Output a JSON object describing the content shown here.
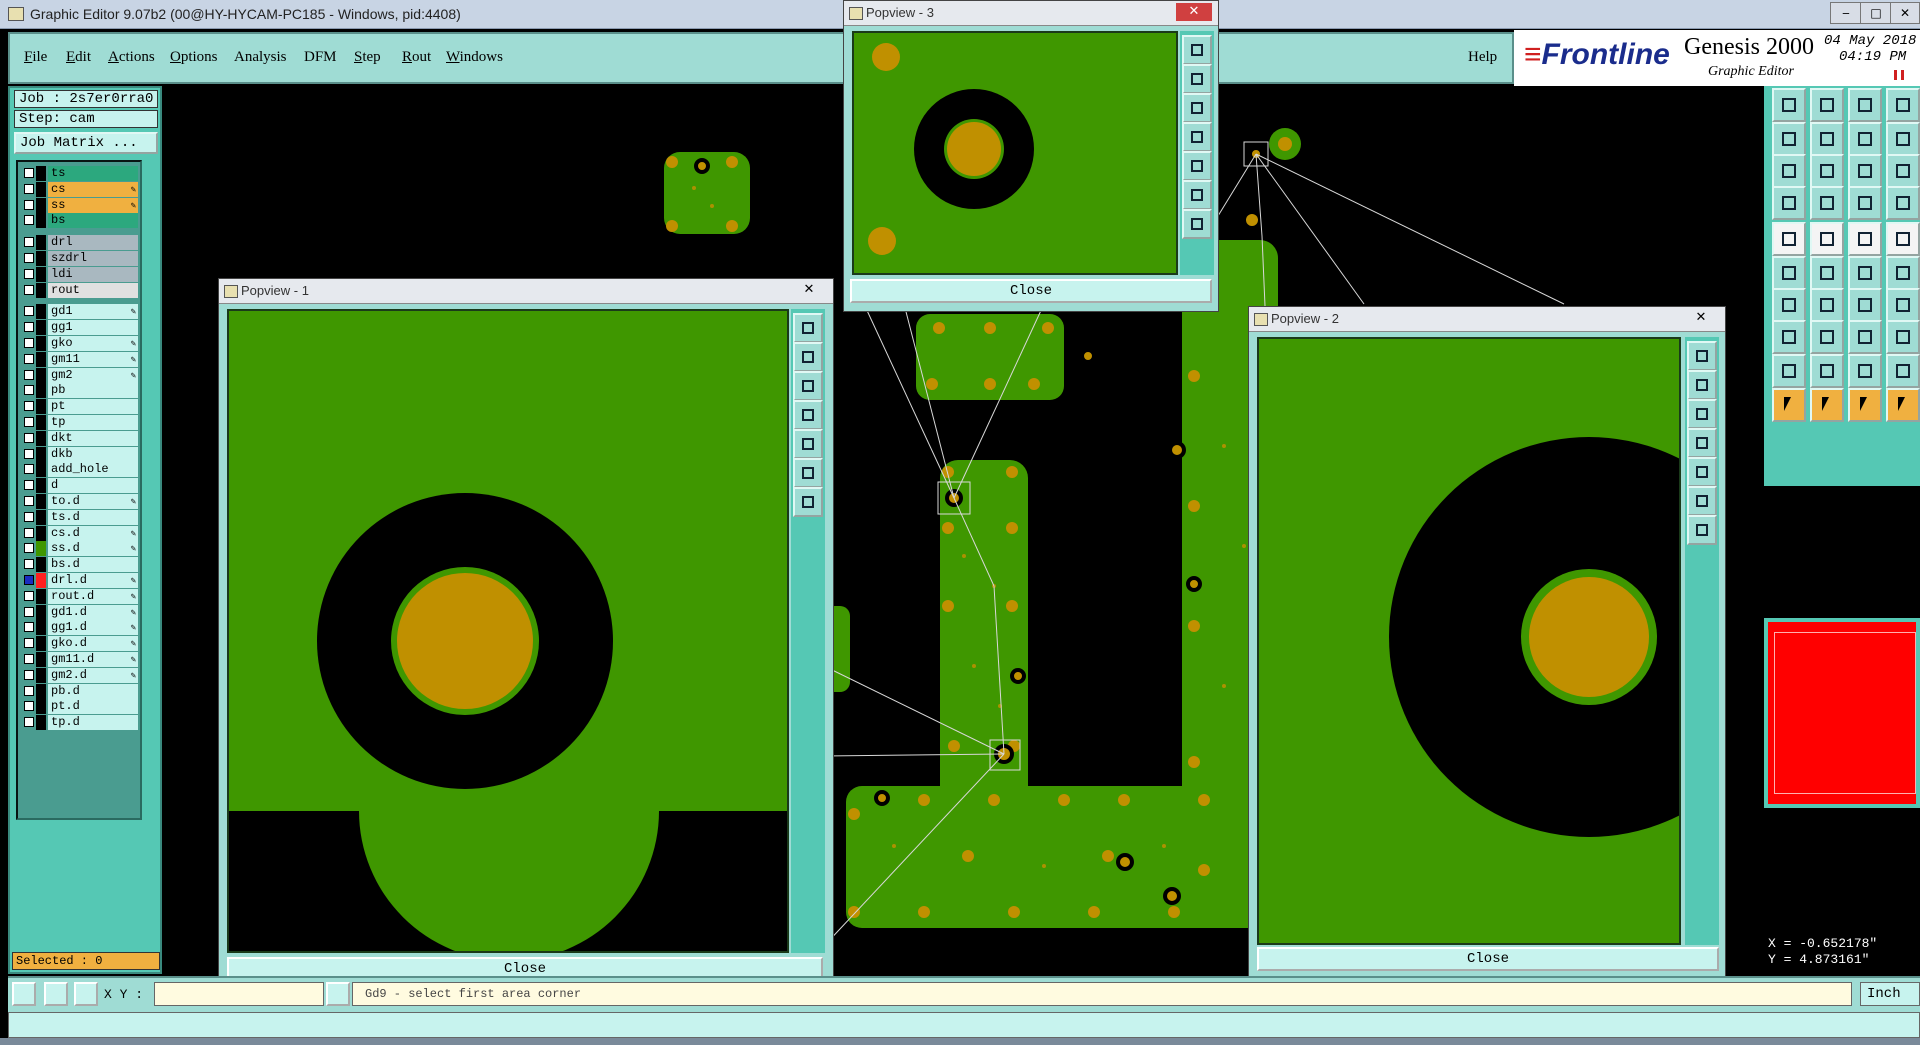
{
  "window": {
    "title": "Graphic Editor 9.07b2 (00@HY-HYCAM-PC185 - Windows, pid:4408)",
    "min_glyph": "‒",
    "max_glyph": "□",
    "close_glyph": "✕"
  },
  "menu": [
    {
      "label": "File",
      "u": "F",
      "rest": "ile"
    },
    {
      "label": "Edit",
      "u": "E",
      "rest": "dit"
    },
    {
      "label": "Actions",
      "u": "A",
      "rest": "ctions"
    },
    {
      "label": "Options",
      "u": "O",
      "rest": "ptions"
    },
    {
      "label": "Analysis",
      "u": "",
      "rest": "Analysis"
    },
    {
      "label": "DFM",
      "u": "",
      "rest": "DFM"
    },
    {
      "label": "Step",
      "u": "S",
      "rest": "tep"
    },
    {
      "label": "Rout",
      "u": "R",
      "rest": "out"
    },
    {
      "label": "Windows",
      "u": "W",
      "rest": "indows"
    }
  ],
  "help_label": "Help",
  "brand": {
    "logo_prefix": "≡",
    "logo": "Frontline",
    "product": "Genesis 2000",
    "module": "Graphic Editor",
    "date": "04 May 2018",
    "time": "04:19 PM"
  },
  "job_panel": {
    "job": "Job : 2s7er0rra0",
    "step": "Step: cam",
    "job_matrix_label": "Job Matrix ...",
    "selected": "Selected : 0"
  },
  "layers": [
    {
      "name": "ts",
      "color": "#2ca87e",
      "swatch": "#000",
      "edit": false,
      "group": 0
    },
    {
      "name": "cs",
      "color": "#f0b040",
      "swatch": "#000",
      "edit": true,
      "group": 0
    },
    {
      "name": "ss",
      "color": "#f0b040",
      "swatch": "#000",
      "edit": true,
      "group": 0
    },
    {
      "name": "bs",
      "color": "#2ca87e",
      "swatch": "#000",
      "edit": false,
      "group": 0
    },
    {
      "name": "drl",
      "color": "#a9b8c0",
      "swatch": "#000",
      "edit": false,
      "group": 1
    },
    {
      "name": "szdrl",
      "color": "#a9b8c0",
      "swatch": "#000",
      "edit": false,
      "group": 1
    },
    {
      "name": "ldi",
      "color": "#a9b8c0",
      "swatch": "#000",
      "edit": false,
      "group": 1
    },
    {
      "name": "rout",
      "color": "#e0e0e0",
      "swatch": "#000",
      "edit": false,
      "group": 1
    },
    {
      "name": "gd1",
      "color": "#c7f3ee",
      "swatch": "#000",
      "edit": true,
      "group": 2
    },
    {
      "name": "gg1",
      "color": "#c7f3ee",
      "swatch": "#000",
      "edit": false,
      "group": 2
    },
    {
      "name": "gko",
      "color": "#c7f3ee",
      "swatch": "#000",
      "edit": true,
      "group": 2
    },
    {
      "name": "gm11",
      "color": "#c7f3ee",
      "swatch": "#000",
      "edit": true,
      "group": 2
    },
    {
      "name": "gm2",
      "color": "#c7f3ee",
      "swatch": "#000",
      "edit": true,
      "group": 2
    },
    {
      "name": "pb",
      "color": "#c7f3ee",
      "swatch": "#000",
      "edit": false,
      "group": 2
    },
    {
      "name": "pt",
      "color": "#c7f3ee",
      "swatch": "#000",
      "edit": false,
      "group": 2
    },
    {
      "name": "tp",
      "color": "#c7f3ee",
      "swatch": "#000",
      "edit": false,
      "group": 2
    },
    {
      "name": "dkt",
      "color": "#c7f3ee",
      "swatch": "#000",
      "edit": false,
      "group": 2
    },
    {
      "name": "dkb",
      "color": "#c7f3ee",
      "swatch": "#000",
      "edit": false,
      "group": 2
    },
    {
      "name": "add_hole",
      "color": "#c7f3ee",
      "swatch": "#000",
      "edit": false,
      "group": 2
    },
    {
      "name": "d",
      "color": "#c7f3ee",
      "swatch": "#000",
      "edit": false,
      "group": 2
    },
    {
      "name": "to.d",
      "color": "#c7f3ee",
      "swatch": "#000",
      "edit": true,
      "group": 2
    },
    {
      "name": "ts.d",
      "color": "#c7f3ee",
      "swatch": "#000",
      "edit": false,
      "group": 2
    },
    {
      "name": "cs.d",
      "color": "#c7f3ee",
      "swatch": "#000",
      "edit": true,
      "group": 2
    },
    {
      "name": "ss.d",
      "color": "#c7f3ee",
      "swatch": "#3f9700",
      "edit": true,
      "group": 2
    },
    {
      "name": "bs.d",
      "color": "#c7f3ee",
      "swatch": "#000",
      "edit": false,
      "group": 2
    },
    {
      "name": "drl.d",
      "color": "#c7f3ee",
      "swatch": "#ff2020",
      "edit": true,
      "group": 2,
      "checked": true
    },
    {
      "name": "rout.d",
      "color": "#c7f3ee",
      "swatch": "#000",
      "edit": true,
      "group": 2
    },
    {
      "name": "gd1.d",
      "color": "#c7f3ee",
      "swatch": "#000",
      "edit": true,
      "group": 2
    },
    {
      "name": "gg1.d",
      "color": "#c7f3ee",
      "swatch": "#000",
      "edit": true,
      "group": 2
    },
    {
      "name": "gko.d",
      "color": "#c7f3ee",
      "swatch": "#000",
      "edit": true,
      "group": 2
    },
    {
      "name": "gm11.d",
      "color": "#c7f3ee",
      "swatch": "#000",
      "edit": true,
      "group": 2
    },
    {
      "name": "gm2.d",
      "color": "#c7f3ee",
      "swatch": "#000",
      "edit": true,
      "group": 2
    },
    {
      "name": "pb.d",
      "color": "#c7f3ee",
      "swatch": "#000",
      "edit": false,
      "group": 2
    },
    {
      "name": "pt.d",
      "color": "#c7f3ee",
      "swatch": "#000",
      "edit": false,
      "group": 2
    },
    {
      "name": "tp.d",
      "color": "#c7f3ee",
      "swatch": "#000",
      "edit": false,
      "group": 2
    }
  ],
  "popviews": {
    "p1": {
      "title": "Popview - 1",
      "close_label": "Close",
      "close_glyph": "✕"
    },
    "p2": {
      "title": "Popview - 2",
      "close_label": "Close",
      "close_glyph": "✕"
    },
    "p3": {
      "title": "Popview - 3",
      "close_label": "Close",
      "close_glyph": "✕"
    }
  },
  "bottom": {
    "xy_label": "X Y :",
    "xy_value": "",
    "status_text": "Gd9 - select first area corner",
    "unit": "Inch"
  },
  "coords": {
    "x": "X = -0.652178\"",
    "y": "Y = 4.873161\""
  },
  "colors": {
    "copper": "#3f9700",
    "pad": "#c09000",
    "background": "#000000",
    "panel": "#55c8b4",
    "menu": "#9fdcd4"
  }
}
